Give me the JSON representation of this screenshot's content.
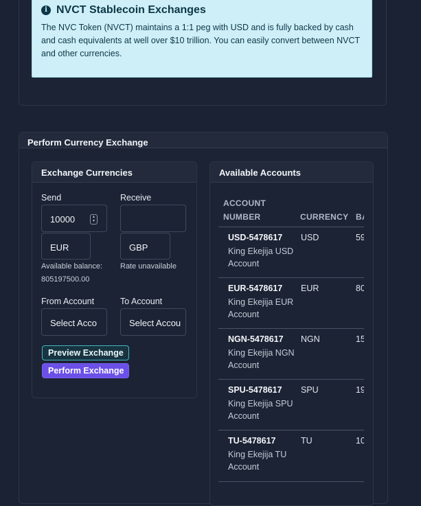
{
  "info": {
    "title": "NVCT Stablecoin Exchanges",
    "text": "The NVC Token (NVCT) maintains a 1:1 peg with USD and is fully backed by cash and cash equivalents at well over $10 trillion. You can easily convert between NVCT and other currencies."
  },
  "exchange_card": {
    "title": "Perform Currency Exchange"
  },
  "exchange_panel": {
    "title": "Exchange Currencies",
    "send_label": "Send",
    "receive_label": "Receive",
    "send_amount": "10000",
    "receive_amount": "",
    "send_currency": "EUR",
    "receive_currency": "GBP",
    "available_balance_label": "Available balance:",
    "available_balance_value": "805197500.00",
    "rate_text": "Rate unavailable",
    "from_account_label": "From Account",
    "to_account_label": "To Account",
    "from_account_value": "Select Acco",
    "to_account_value": "Select Accou",
    "preview_button": "Preview Exchange",
    "perform_button": "Perform Exchange"
  },
  "accounts_panel": {
    "title": "Available Accounts",
    "headers": {
      "account_number_line1": "ACCOUNT",
      "account_number_line2": "NUMBER",
      "currency": "CURRENCY",
      "balance": "BA"
    },
    "rows": [
      {
        "account": "USD-5478617",
        "owner": "King Ekejija USD Account",
        "currency": "USD",
        "balance": "59"
      },
      {
        "account": "EUR-5478617",
        "owner": "King Ekejija EUR Account",
        "currency": "EUR",
        "balance": "80"
      },
      {
        "account": "NGN-5478617",
        "owner": "King Ekejija NGN Account",
        "currency": "NGN",
        "balance": "15"
      },
      {
        "account": "SPU-5478617",
        "owner": "King Ekejija SPU Account",
        "currency": "SPU",
        "balance": "19"
      },
      {
        "account": "TU-5478617",
        "owner": "King Ekejija TU Account",
        "currency": "TU",
        "balance": "10"
      }
    ]
  },
  "icons": {
    "info": "info-circle-icon",
    "stepper": "number-stepper-icon"
  },
  "colors": {
    "background": "#1b2233",
    "info_bg": "#cfeff8",
    "preview_border": "#44b7c5",
    "perform_bg": "#6b50e8"
  }
}
